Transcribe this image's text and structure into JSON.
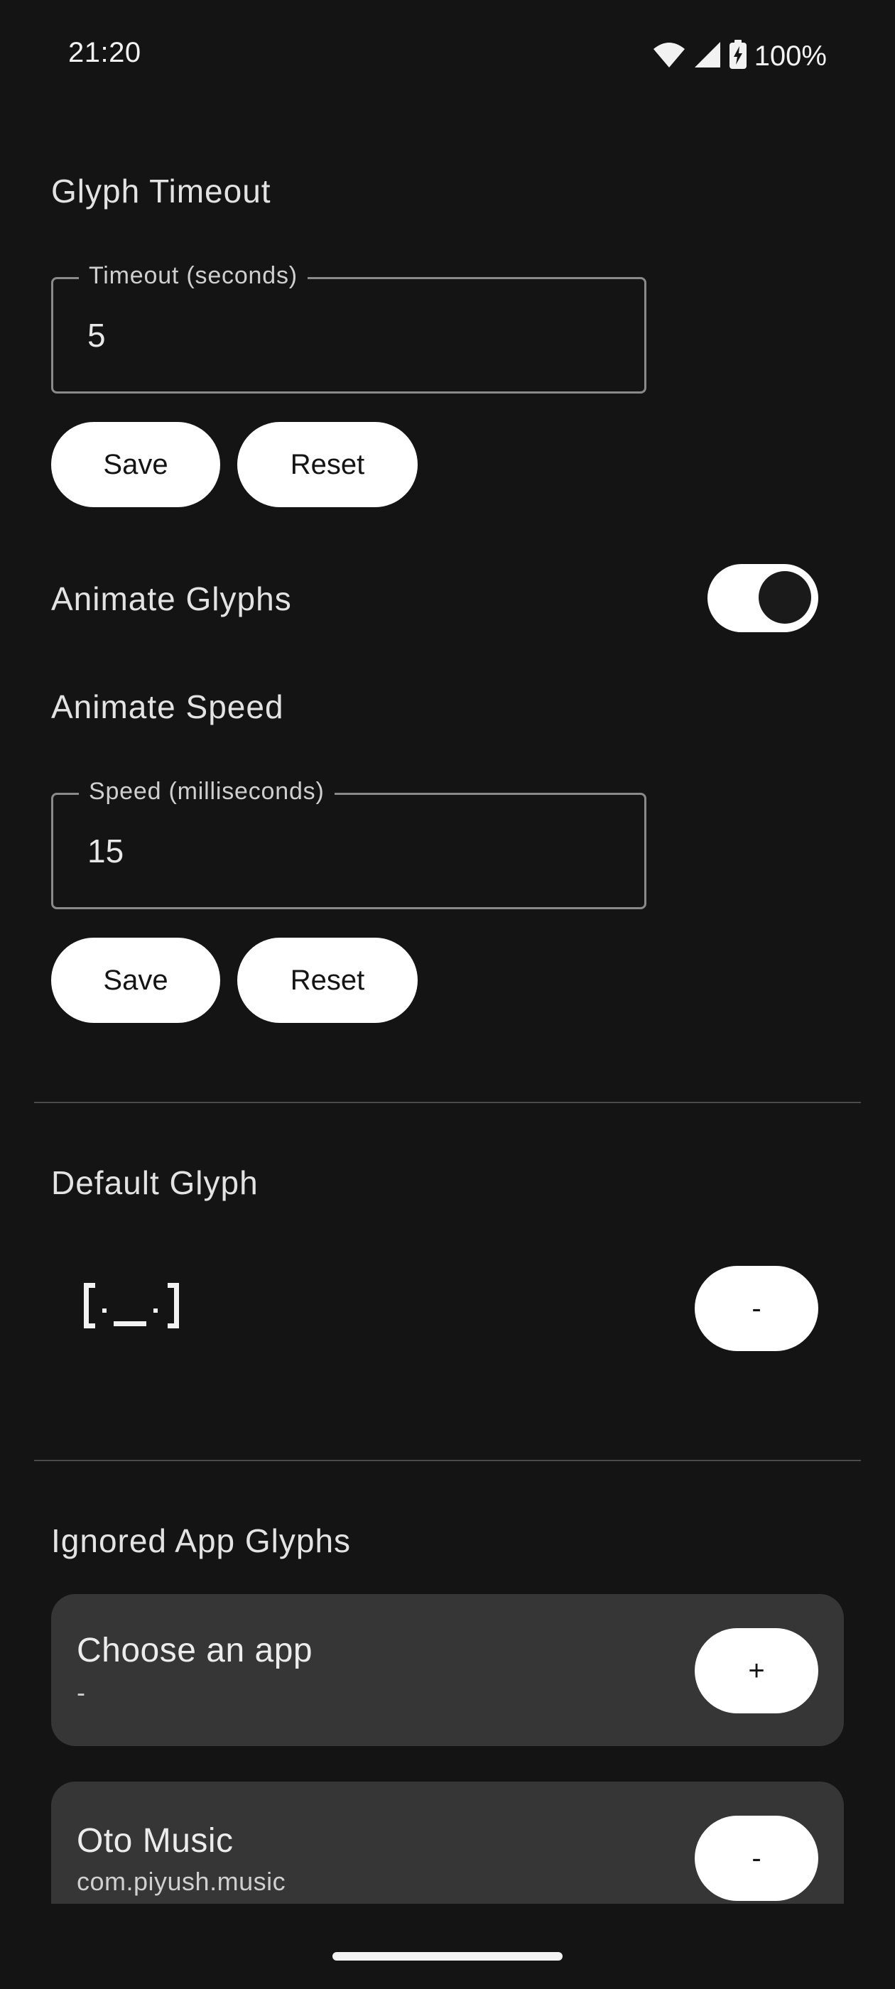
{
  "status_bar": {
    "time": "21:20",
    "battery": "100%",
    "icons": [
      "wifi-icon",
      "signal-icon",
      "battery-charging-icon"
    ]
  },
  "glyph_timeout": {
    "heading": "Glyph Timeout",
    "field_label": "Timeout (seconds)",
    "field_value": "5",
    "save_label": "Save",
    "reset_label": "Reset"
  },
  "animate_glyphs": {
    "label": "Animate Glyphs",
    "enabled": true
  },
  "animate_speed": {
    "heading": "Animate Speed",
    "field_label": "Speed (milliseconds)",
    "field_value": "15",
    "save_label": "Save",
    "reset_label": "Reset"
  },
  "default_glyph": {
    "heading": "Default Glyph",
    "glyph_icon": "pixel-face-glyph-icon",
    "button_label": "-"
  },
  "ignored_apps": {
    "heading": "Ignored App Glyphs",
    "items": [
      {
        "title": "Choose an app",
        "subtitle": "-",
        "button_label": "+"
      },
      {
        "title": "Oto Music",
        "subtitle": "com.piyush.music",
        "button_label": "-"
      }
    ]
  },
  "colors": {
    "background": "#141414",
    "surface": "#363636",
    "button": "#ffffff",
    "text": "#e6e6e6"
  }
}
